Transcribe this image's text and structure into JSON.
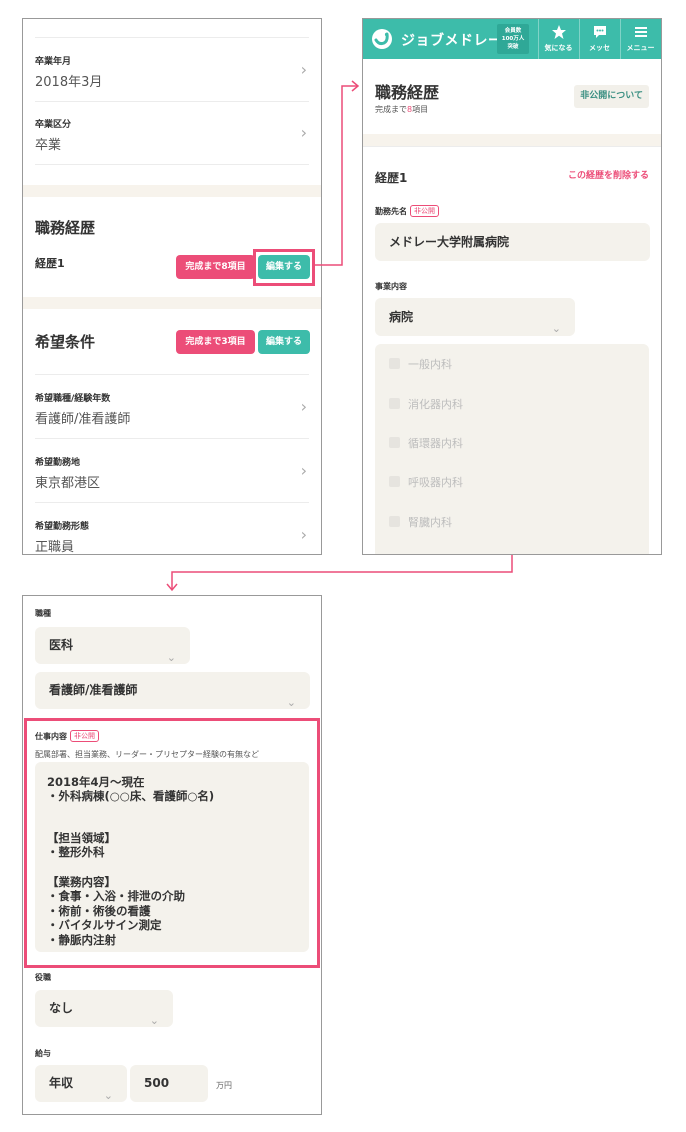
{
  "colors": {
    "brand_teal": "#3dbcaa",
    "accent_pink": "#ec4d78",
    "cream_band": "#f7f3ec"
  },
  "panel_a": {
    "rows_top": [
      {
        "label": "卒業年月",
        "value": "2018年3月"
      },
      {
        "label": "卒業区分",
        "value": "卒業"
      }
    ],
    "career_section": {
      "title": "職務経歴",
      "entry_label": "経歴1",
      "remaining_badge": "完成まで8項目",
      "edit_button": "編集する"
    },
    "desired_section": {
      "title": "希望条件",
      "remaining_badge": "完成まで3項目",
      "edit_button": "編集する",
      "rows": [
        {
          "label": "希望職種/経験年数",
          "value": "看護師/准看護師"
        },
        {
          "label": "希望勤務地",
          "value": "東京都港区"
        },
        {
          "label": "希望勤務形態",
          "value": "正職員"
        }
      ]
    }
  },
  "panel_b": {
    "header": {
      "logo_text": "ジョブメドレー",
      "members_badge": [
        "会員数",
        "100万人",
        "突破"
      ],
      "buttons": [
        {
          "icon": "star-icon",
          "label": "気になる"
        },
        {
          "icon": "message-icon",
          "label": "メッセ"
        },
        {
          "icon": "menu-icon",
          "label": "メニュー"
        }
      ]
    },
    "title": "職務経歴",
    "progress_prefix": "完成まで",
    "progress_count": "8",
    "progress_suffix": "項目",
    "private_button": "非公開について",
    "career_title": "経歴1",
    "delete_link": "この経歴を削除する",
    "employer_label": "勤務先名",
    "private_tag": "非公開",
    "employer_value": "メドレー大学附属病院",
    "business_label": "事業内容",
    "business_value": "病院",
    "departments": [
      "一般内科",
      "消化器内科",
      "循環器内科",
      "呼吸器内科",
      "腎臓内科"
    ]
  },
  "panel_c": {
    "occupation_label": "職種",
    "occupation_category": "医科",
    "occupation_value": "看護師/准看護師",
    "job_content_label": "仕事内容",
    "private_tag": "非公開",
    "job_content_hint": "配属部署、担当業務、リーダー・プリセプター経験の有無など",
    "job_content_lines": [
      "2018年4月〜現在",
      "・外科病棟(○○床、看護師○名)",
      "",
      "",
      "【担当領域】",
      "・整形外科",
      "",
      "【業務内容】",
      "・食事・入浴・排泄の介助",
      "・術前・術後の看護",
      "・バイタルサイン測定",
      "・静脈内注射"
    ],
    "position_label": "役職",
    "position_value": "なし",
    "salary_label": "給与",
    "salary_type": "年収",
    "salary_amount": "500",
    "salary_unit": "万円"
  }
}
